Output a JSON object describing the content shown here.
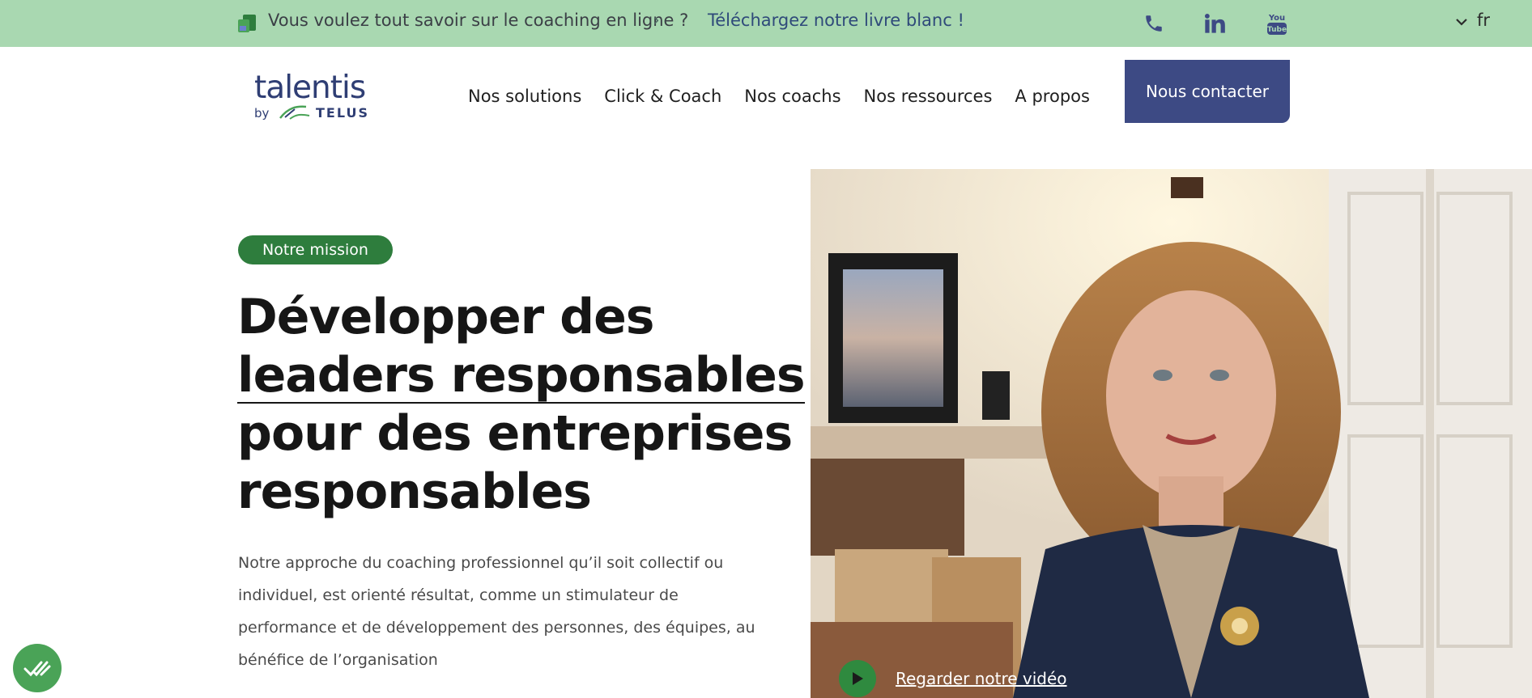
{
  "topbar": {
    "promo_text": "Vous voulez tout savoir sur le coaching en ligne ?",
    "promo_link": "Téléchargez notre livre blanc !",
    "language": "fr",
    "icons": [
      "document-icon",
      "chevron-right-icon",
      "phone-icon",
      "linkedin-icon",
      "youtube-icon",
      "chevron-down-icon"
    ]
  },
  "header": {
    "logo_brand": "talentis",
    "logo_by": "by",
    "logo_partner": "TELUS",
    "nav": [
      {
        "label": "Nos solutions"
      },
      {
        "label": "Click & Coach"
      },
      {
        "label": "Nos coachs"
      },
      {
        "label": "Nos ressources"
      },
      {
        "label": "A propos"
      }
    ],
    "cta_label": "Nous contacter"
  },
  "hero": {
    "badge": "Notre mission",
    "headline": {
      "line1": "Développer des",
      "line2": "leaders responsables",
      "line3": "pour des entreprises",
      "line4": "responsables"
    },
    "body": "Notre approche du coaching professionnel qu’il soit collectif ou individuel, est orienté résultat, comme un stimulateur de performance et de développement des personnes, des équipes, au bénéfice de l’organisation",
    "video_label": "Regarder notre vidéo"
  },
  "colors": {
    "topbar_bg": "#a9d8b1",
    "brand_navy": "#3d4a84",
    "badge_green": "#2e7d3d",
    "play_green": "#2f8a3f",
    "widget_green": "#4aa357"
  }
}
